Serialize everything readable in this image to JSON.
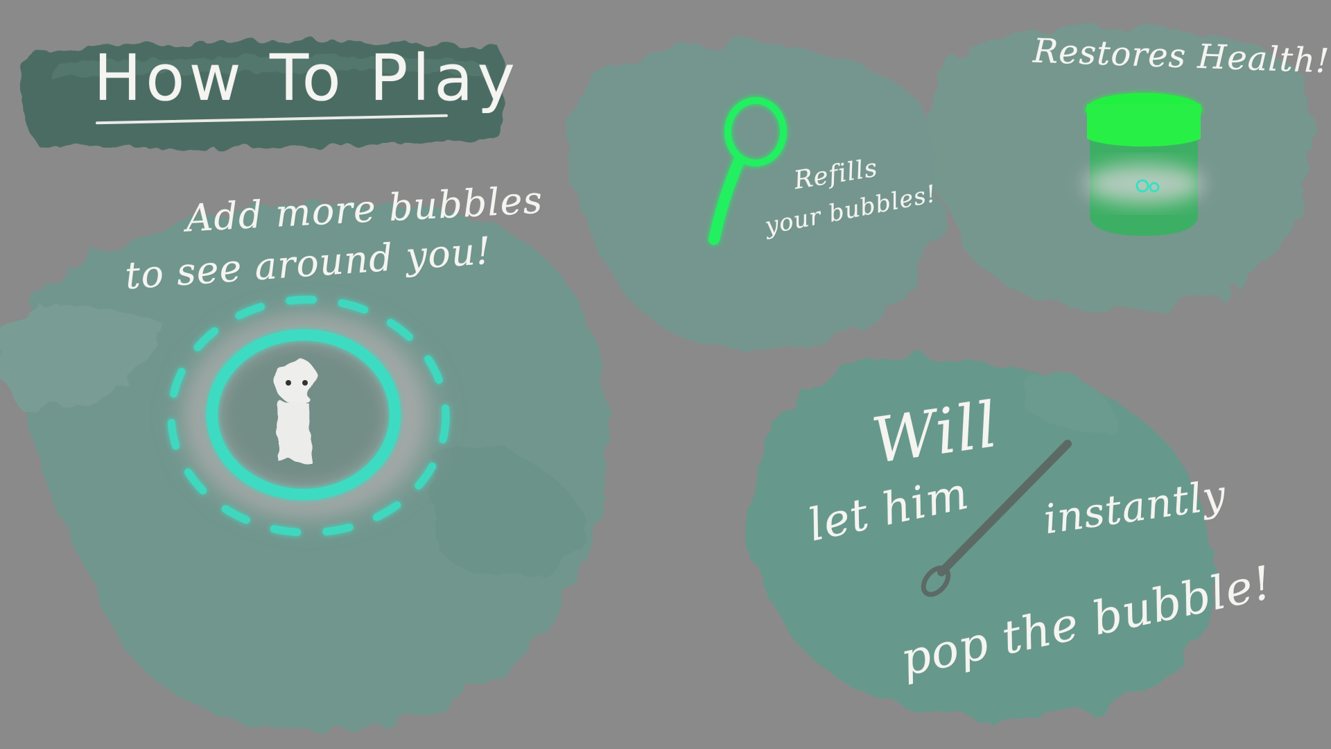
{
  "title": "How To Play",
  "bubbles_tip": {
    "line1": "Add more bubbles",
    "line2": "to see around you!"
  },
  "refill_tip": {
    "line1": "Refills",
    "line2": "your bubbles!"
  },
  "health_tip": {
    "label": "Restores Health!"
  },
  "needle_tip": {
    "line1": "Will",
    "line2": "let him",
    "line3": "instantly",
    "line4": "pop the bubble!"
  },
  "colors": {
    "background": "#8a8a8a",
    "paint_teal": "#6f9a90",
    "banner_dark": "#4a6b63",
    "bubble_cyan": "#38e0c0",
    "item_green": "#22f060",
    "text": "#f4f4f0"
  },
  "icons": [
    "magnifier-bubble-wand-icon",
    "health-jar-icon",
    "needle-icon",
    "bubble-player-icon"
  ]
}
